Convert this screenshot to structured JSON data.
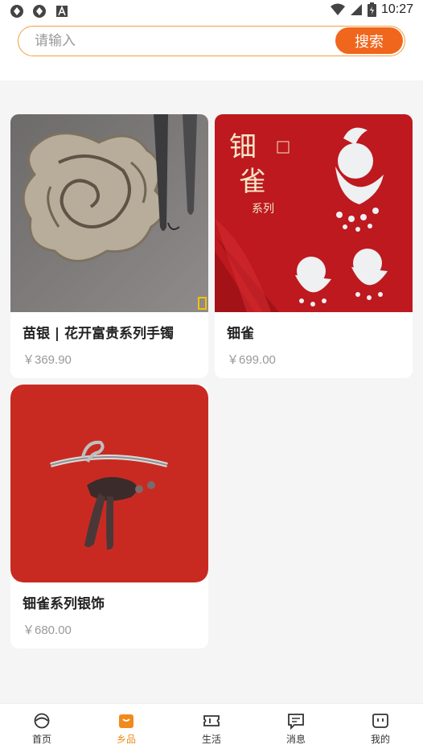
{
  "status_bar": {
    "time": "10:27"
  },
  "search": {
    "placeholder": "请输入",
    "value": "",
    "button_label": "搜索"
  },
  "products": [
    {
      "title": "苗银 | 花开富贵系列手镯",
      "price": "￥369.90"
    },
    {
      "title": "钿雀",
      "price": "￥699.00"
    },
    {
      "title": "钿雀系列银饰",
      "price": "￥680.00"
    }
  ],
  "tabbar": {
    "items": [
      {
        "label": "首页",
        "icon": "home-icon"
      },
      {
        "label": "乡品",
        "icon": "shop-bag-icon"
      },
      {
        "label": "生活",
        "icon": "ticket-icon"
      },
      {
        "label": "消息",
        "icon": "message-icon"
      },
      {
        "label": "我的",
        "icon": "profile-icon"
      }
    ],
    "active_index": 1
  },
  "colors": {
    "accent": "#f0661c",
    "active_tab": "#f08a1c",
    "search_border": "#f0a040"
  }
}
